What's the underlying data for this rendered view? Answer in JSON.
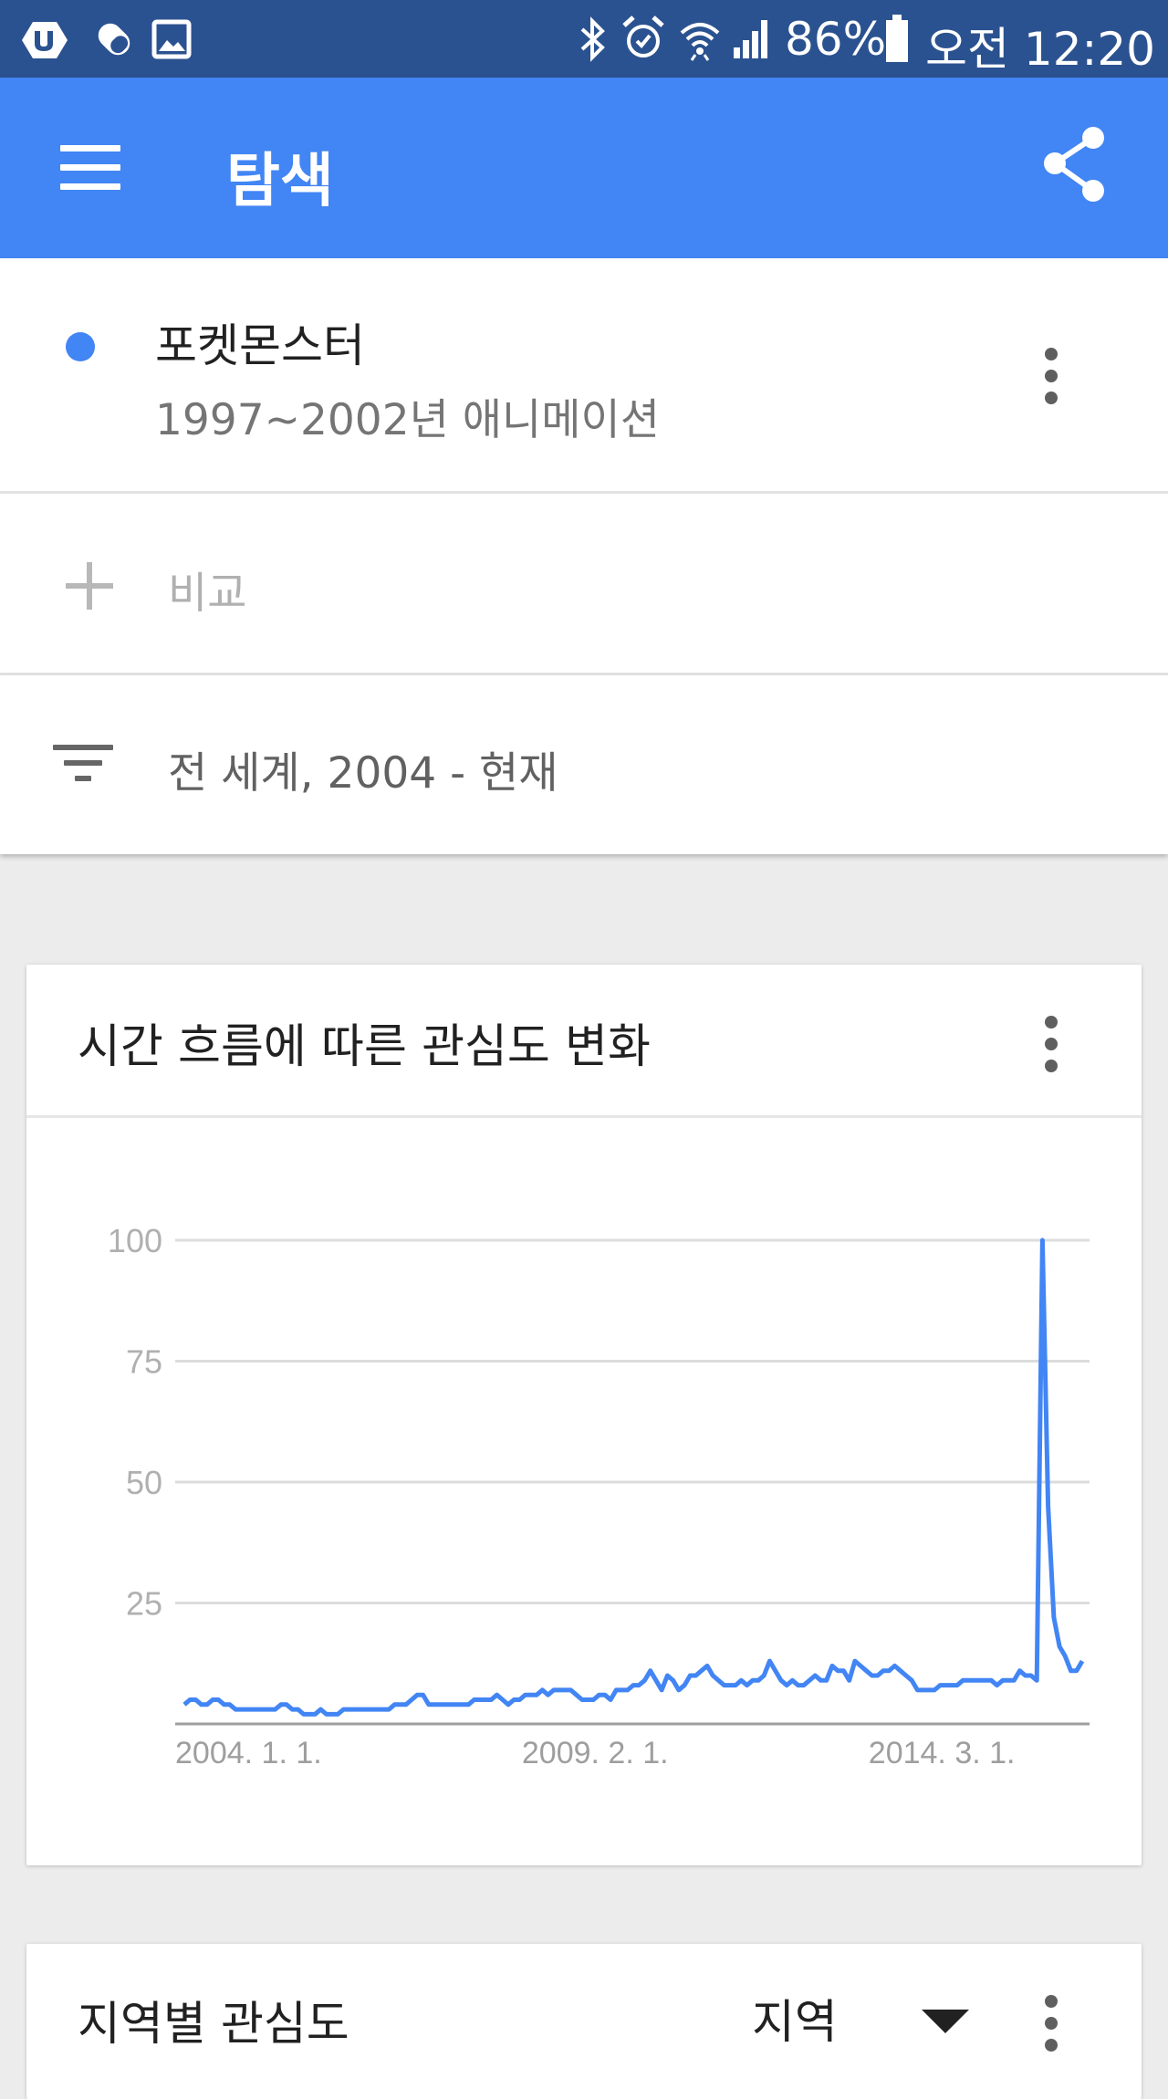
{
  "status_bar": {
    "battery": "86%",
    "time": "오전 12:20",
    "icons": [
      "app-u-icon",
      "pill-icon",
      "gallery-icon",
      "bluetooth-icon",
      "alarm-icon",
      "wifi-icon",
      "signal-icon",
      "battery-icon"
    ]
  },
  "appbar": {
    "title": "탐색",
    "menu_icon": "menu-icon",
    "share_icon": "share-icon"
  },
  "search_term": {
    "title": "포켓몬스터",
    "subtitle": "1997~2002년 애니메이션",
    "color": "#4285f4"
  },
  "compare": {
    "label": "비교"
  },
  "filter": {
    "label": "전 세계, 2004 - 현재"
  },
  "interest_over_time": {
    "title": "시간 흐름에 따른 관심도 변화"
  },
  "region": {
    "title": "지역별 관심도",
    "select_value": "지역"
  },
  "colors": {
    "status_bar": "#2b5290",
    "app_bar": "#4285f4",
    "line": "#4285f4"
  },
  "chart_data": {
    "type": "line",
    "title": "시간 흐름에 따른 관심도 변화",
    "xlabel": "",
    "ylabel": "",
    "ylim": [
      0,
      100
    ],
    "yticks": [
      25,
      50,
      75,
      100
    ],
    "grid": true,
    "x_tick_labels": [
      "2004. 1. 1.",
      "2009. 2. 1.",
      "2014. 3. 1."
    ],
    "x_tick_index": [
      0,
      61,
      122
    ],
    "series": [
      {
        "values": [
          4,
          5,
          5,
          4,
          4,
          5,
          5,
          4,
          4,
          3,
          3,
          3,
          3,
          3,
          3,
          3,
          3,
          4,
          4,
          3,
          3,
          2,
          2,
          2,
          3,
          2,
          2,
          2,
          3,
          3,
          3,
          3,
          3,
          3,
          3,
          3,
          3,
          4,
          4,
          4,
          5,
          6,
          6,
          4,
          4,
          4,
          4,
          4,
          4,
          4,
          4,
          5,
          5,
          5,
          5,
          6,
          5,
          4,
          5,
          5,
          6,
          6,
          6,
          7,
          6,
          7,
          7,
          7,
          7,
          6,
          5,
          5,
          5,
          6,
          6,
          5,
          7,
          7,
          7,
          8,
          8,
          9,
          11,
          9,
          7,
          10,
          9,
          7,
          8,
          10,
          10,
          11,
          12,
          10,
          9,
          8,
          8,
          8,
          9,
          8,
          9,
          9,
          10,
          13,
          11,
          9,
          8,
          9,
          8,
          8,
          9,
          10,
          9,
          9,
          12,
          11,
          11,
          9,
          13,
          12,
          11,
          10,
          10,
          11,
          11,
          12,
          11,
          10,
          9,
          7,
          7,
          7,
          7,
          8,
          8,
          8,
          8,
          9,
          9,
          9,
          9,
          9,
          9,
          8,
          9,
          9,
          9,
          11,
          10,
          10,
          9,
          100,
          45,
          22,
          16,
          14,
          11,
          11,
          13
        ]
      }
    ]
  }
}
